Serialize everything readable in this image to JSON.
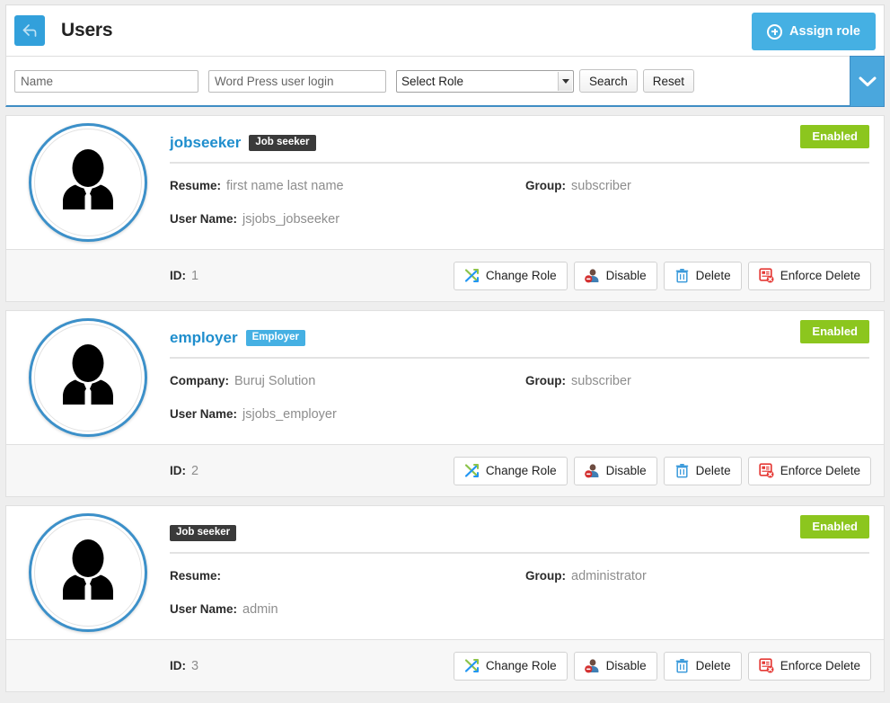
{
  "header": {
    "back_icon": "arrow-left-icon",
    "title": "Users",
    "assign_button": {
      "label": "Assign role",
      "icon": "plus-circle-icon",
      "color": "#45b0e3"
    }
  },
  "toolbar": {
    "name_placeholder": "Name",
    "name_value": "",
    "login_placeholder": "Word Press user login",
    "login_value": "",
    "role_select": {
      "selected": "Select Role",
      "options": [
        "Select Role"
      ]
    },
    "search_label": "Search",
    "reset_label": "Reset",
    "toggle_icon": "chevron-down-icon",
    "accent_color": "#4aa7dd"
  },
  "labels": {
    "id": "ID:",
    "group": "Group:",
    "resume": "Resume:",
    "company": "Company:",
    "user_name": "User Name:"
  },
  "actions": [
    {
      "label": "Change Role",
      "icon": "shuffle-arrows-icon"
    },
    {
      "label": "Disable",
      "icon": "user-block-icon"
    },
    {
      "label": "Delete",
      "icon": "trash-icon"
    },
    {
      "label": "Enforce Delete",
      "icon": "form-delete-icon"
    }
  ],
  "status_colors": {
    "enabled": "#8cc61e"
  },
  "users": [
    {
      "username": "jobseeker",
      "role_badge": "Job seeker",
      "role_badge_type": "jobseeker",
      "status": "Enabled",
      "field1_label": "Resume:",
      "field1_value": "first name last name",
      "group_label": "Group:",
      "group_value": "subscriber",
      "user_name_label": "User Name:",
      "user_name_value": "jsjobs_jobseeker",
      "id_label": "ID:",
      "id_value": "1",
      "avatar_icon": "user-suit-icon"
    },
    {
      "username": "employer",
      "role_badge": "Employer",
      "role_badge_type": "employer",
      "status": "Enabled",
      "field1_label": "Company:",
      "field1_value": "Buruj Solution",
      "group_label": "Group:",
      "group_value": "subscriber",
      "user_name_label": "User Name:",
      "user_name_value": "jsjobs_employer",
      "id_label": "ID:",
      "id_value": "2",
      "avatar_icon": "user-suit-icon"
    },
    {
      "username": "",
      "role_badge": "Job seeker",
      "role_badge_type": "jobseeker",
      "status": "Enabled",
      "field1_label": "Resume:",
      "field1_value": "",
      "group_label": "Group:",
      "group_value": "administrator",
      "user_name_label": "User Name:",
      "user_name_value": "admin",
      "id_label": "ID:",
      "id_value": "3",
      "avatar_icon": "user-suit-icon"
    }
  ]
}
